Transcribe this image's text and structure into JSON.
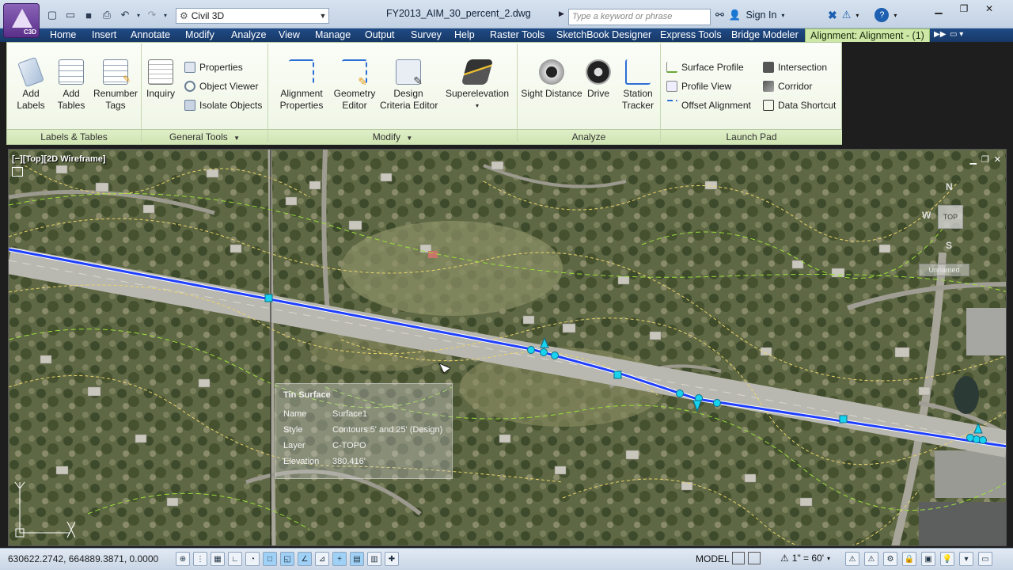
{
  "window": {
    "app_badge": "C3D",
    "workspace": "Civil 3D",
    "document_title": "FY2013_AIM_30_percent_2.dwg",
    "search_placeholder": "Type a keyword or phrase",
    "sign_in": "Sign In"
  },
  "tabs": [
    {
      "label": "Home",
      "active": false
    },
    {
      "label": "Insert",
      "active": false
    },
    {
      "label": "Annotate",
      "active": false
    },
    {
      "label": "Modify",
      "active": false
    },
    {
      "label": "Analyze",
      "active": false
    },
    {
      "label": "View",
      "active": false
    },
    {
      "label": "Manage",
      "active": false
    },
    {
      "label": "Output",
      "active": false
    },
    {
      "label": "Survey",
      "active": false
    },
    {
      "label": "Help",
      "active": false
    },
    {
      "label": "Raster Tools",
      "active": false
    },
    {
      "label": "SketchBook Designer",
      "active": false
    },
    {
      "label": "Express Tools",
      "active": false
    },
    {
      "label": "Bridge Modeler",
      "active": false
    },
    {
      "label": "Alignment: Alignment - (1)",
      "active": true
    }
  ],
  "ribbon": {
    "labels_tables": {
      "title": "Labels & Tables",
      "add_labels": "Add\nLabels",
      "add_tables": "Add\nTables",
      "renumber_tags": "Renumber\nTags"
    },
    "general_tools": {
      "title": "General Tools",
      "inquiry": "Inquiry",
      "properties": "Properties",
      "object_viewer": "Object Viewer",
      "isolate_objects": "Isolate Objects"
    },
    "modify": {
      "title": "Modify",
      "alignment_properties": "Alignment\nProperties",
      "geometry_editor": "Geometry\nEditor",
      "design_criteria_editor": "Design\nCriteria Editor",
      "superelevation": "Superelevation"
    },
    "analyze": {
      "title": "Analyze",
      "sight_distance": "Sight Distance",
      "drive": "Drive",
      "station_tracker": "Station\nTracker"
    },
    "launch_pad": {
      "title": "Launch Pad",
      "surface_profile": "Surface Profile",
      "profile_view": "Profile View",
      "offset_alignment": "Offset Alignment",
      "intersection": "Intersection",
      "corridor": "Corridor",
      "data_shortcut": "Data Shortcut"
    }
  },
  "viewport": {
    "label": "[−][Top][2D Wireframe]",
    "viewcube_top": "TOP",
    "compass_n": "N",
    "compass_w": "W",
    "compass_s": "S",
    "ucs_name": "Unnamed"
  },
  "tooltip": {
    "title": "Tin Surface",
    "rows": [
      {
        "key": "Name",
        "value": "Surface1"
      },
      {
        "key": "Style",
        "value": "Contours 5' and 25' (Design)"
      },
      {
        "key": "Layer",
        "value": "C-TOPO"
      },
      {
        "key": "Elevation",
        "value": "380.416'"
      }
    ]
  },
  "statusbar": {
    "coordinates": "630622.2742, 664889.3871, 0.0000",
    "model": "MODEL",
    "scale": "1\" = 60'"
  },
  "colors": {
    "alignment": "#1f3fff",
    "grips": "#19d3ee",
    "contour_major": "#9be03a",
    "contour_minor": "#e8d36a",
    "active_tab": "#cde8a6"
  }
}
